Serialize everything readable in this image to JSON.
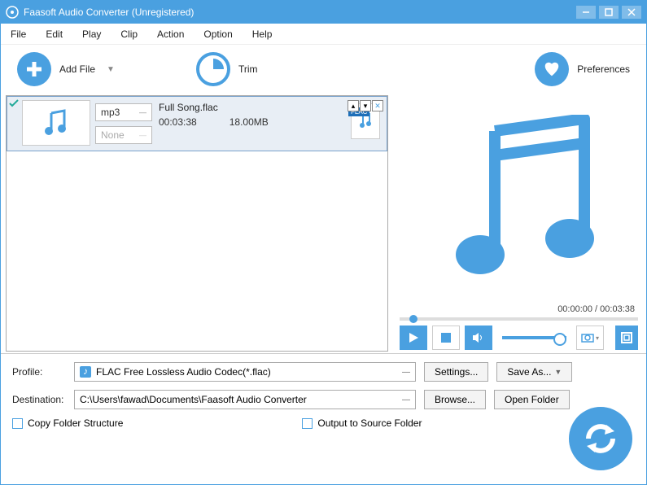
{
  "window": {
    "title": "Faasoft Audio Converter (Unregistered)"
  },
  "menu": [
    "File",
    "Edit",
    "Play",
    "Clip",
    "Action",
    "Option",
    "Help"
  ],
  "toolbar": {
    "addFile": "Add File",
    "trim": "Trim",
    "preferences": "Preferences"
  },
  "file": {
    "name": "Full Song.flac",
    "duration": "00:03:38",
    "size": "18.00MB",
    "outFormat": "mp3",
    "effect": "None",
    "formatBadge": "FLAC"
  },
  "preview": {
    "time": "00:00:00 / 00:03:38"
  },
  "profile": {
    "label": "Profile:",
    "value": "FLAC Free Lossless Audio Codec(*.flac)",
    "settings": "Settings...",
    "saveAs": "Save As..."
  },
  "destination": {
    "label": "Destination:",
    "value": "C:\\Users\\fawad\\Documents\\Faasoft Audio Converter",
    "browse": "Browse...",
    "openFolder": "Open Folder"
  },
  "options": {
    "copyFolder": "Copy Folder Structure",
    "outputSource": "Output to Source Folder"
  }
}
